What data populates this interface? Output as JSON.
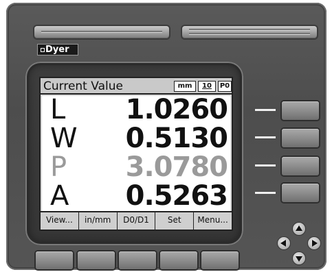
{
  "brand": {
    "logo_text": "Dyer"
  },
  "screen": {
    "title": "Current Value",
    "indicators": {
      "unit": "mm",
      "resolution": "10",
      "mode": "P0"
    },
    "readings": [
      {
        "label": "L",
        "value": "1.0260",
        "dimmed": false
      },
      {
        "label": "W",
        "value": "0.5130",
        "dimmed": false
      },
      {
        "label": "P",
        "value": "3.0780",
        "dimmed": true
      },
      {
        "label": "A",
        "value": "0.5263",
        "dimmed": false
      }
    ],
    "softkeys": [
      "View...",
      "in/mm",
      "D0/D1",
      "Set",
      "Menu..."
    ]
  },
  "colors": {
    "housing": "#555555",
    "lcd_background": "#d9d9d9",
    "dimmed_text": "#9a9a9a"
  },
  "icons": [
    "arrow-up-icon",
    "arrow-left-icon",
    "arrow-right-icon",
    "arrow-down-icon"
  ]
}
